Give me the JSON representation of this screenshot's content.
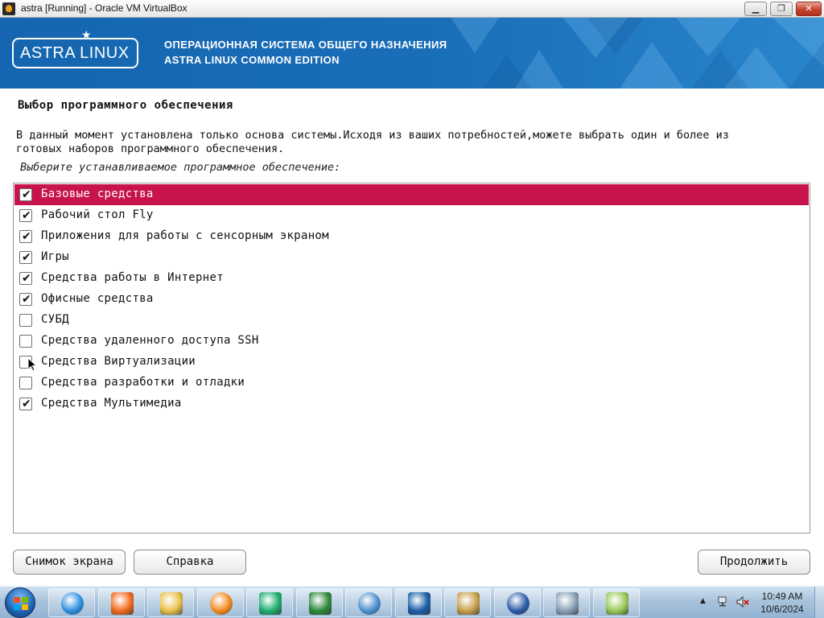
{
  "window": {
    "title": "astra [Running] - Oracle VM VirtualBox",
    "minimize": "▁",
    "maximize": "❐",
    "close": "✕"
  },
  "banner": {
    "logo": "ASTRA LINUX",
    "line1": "ОПЕРАЦИОННАЯ СИСТЕМА ОБЩЕГО НАЗНАЧЕНИЯ",
    "line2": "ASTRA LINUX COMMON EDITION"
  },
  "page": {
    "title": "Выбор программного обеспечения",
    "description_line1": "В данный момент установлена только основа системы.Исходя из ваших потребностей,можете выбрать один и более из",
    "description_line2": "готовых наборов программного обеспечения.",
    "prompt": "Выберите устанавливаемое программное обеспечение:"
  },
  "software": [
    {
      "label": "Базовые средства",
      "checked": true,
      "selected": true
    },
    {
      "label": "Рабочий стол Fly",
      "checked": true,
      "selected": false
    },
    {
      "label": "Приложения для работы с сенсорным экраном",
      "checked": true,
      "selected": false
    },
    {
      "label": "Игры",
      "checked": true,
      "selected": false
    },
    {
      "label": "Средства работы в Интернет",
      "checked": true,
      "selected": false
    },
    {
      "label": "Офисные средства",
      "checked": true,
      "selected": false
    },
    {
      "label": "СУБД",
      "checked": false,
      "selected": false
    },
    {
      "label": "Средства удаленного доступа SSH",
      "checked": false,
      "selected": false
    },
    {
      "label": "Средства Виртуализации",
      "checked": false,
      "selected": false
    },
    {
      "label": "Средства разработки и отладки",
      "checked": false,
      "selected": false
    },
    {
      "label": "Средства Мультимедиа",
      "checked": true,
      "selected": false
    }
  ],
  "buttons": {
    "screenshot": "Снимок экрана",
    "help": "Справка",
    "continue": "Продолжить"
  },
  "taskbar": {
    "apps": [
      {
        "name": "internet-explorer",
        "color": "#2b8fe0"
      },
      {
        "name": "firefox",
        "color": "#f36a1d"
      },
      {
        "name": "file-explorer",
        "color": "#e9c24a"
      },
      {
        "name": "media-player",
        "color": "#f08a1e"
      },
      {
        "name": "chat-app",
        "color": "#1fae6e"
      },
      {
        "name": "terminal-monitor",
        "color": "#2f8a3b"
      },
      {
        "name": "control-panel",
        "color": "#4a8fd1"
      },
      {
        "name": "virtualbox",
        "color": "#1a5fa8"
      },
      {
        "name": "paint",
        "color": "#c9a04a"
      },
      {
        "name": "windows-xp-mode",
        "color": "#2a5aa8"
      },
      {
        "name": "calculator",
        "color": "#8aa0b8"
      },
      {
        "name": "folders",
        "color": "#9bc95a"
      }
    ],
    "time": "10:49 AM",
    "date": "10/6/2024"
  },
  "colors": {
    "selected_row": "#c8134d",
    "banner_blue": "#1a6fb9"
  }
}
